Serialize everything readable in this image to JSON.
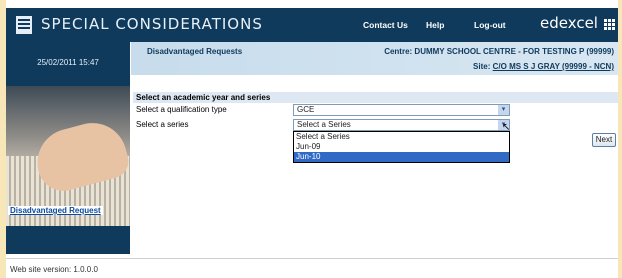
{
  "header": {
    "title": "SPECIAL CONSIDERATIONS",
    "links": [
      "Contact Us",
      "Help",
      "Log-out"
    ],
    "brand": "edexcel"
  },
  "sidebar": {
    "datetime": "25/02/2011 15:47",
    "nav_link": "Disadvantaged Request"
  },
  "page": {
    "title": "Disadvantaged Requests",
    "centre": "Centre: DUMMY SCHOOL CENTRE - FOR TESTING P (99999)",
    "site_label": "Site:",
    "site_value": "C/O MS S J GRAY (99999 - NCN)"
  },
  "form": {
    "section_heading": "Select an academic year and series",
    "qualification_label": "Select a qualification type",
    "qualification_value": "GCE",
    "series_label": "Select a series",
    "series_value": "Select a Series",
    "series_options": [
      "Select a Series",
      "Jun-09",
      "Jun-10"
    ],
    "series_highlighted": "Jun-10",
    "next_label": "Next"
  },
  "footer": {
    "version": "Web site version: 1.0.0.0"
  },
  "colors": {
    "navy": "#0f3a5c",
    "light_blue": "#c7dcec",
    "highlight": "#316ac5",
    "border_bg": "#f6e6b8"
  },
  "icons": [
    "app-logo-icon",
    "edexcel-grid-icon",
    "dropdown-arrow-icon",
    "mouse-cursor-icon"
  ]
}
